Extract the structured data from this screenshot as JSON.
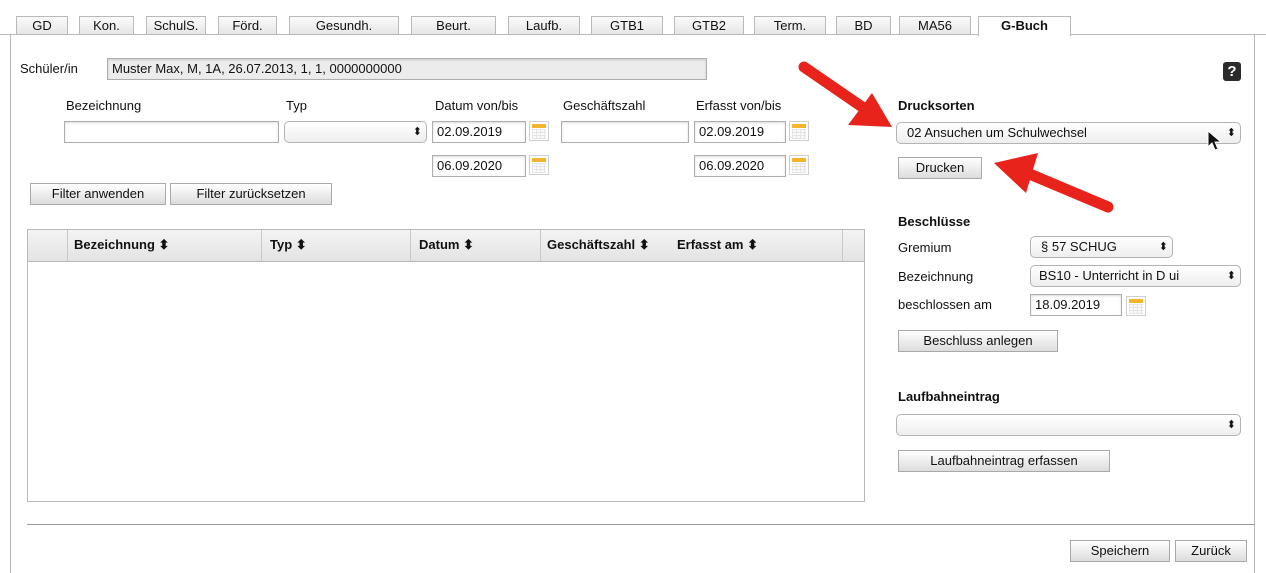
{
  "tabs": [
    {
      "label": "GD"
    },
    {
      "label": "Kon."
    },
    {
      "label": "SchulS."
    },
    {
      "label": "Förd."
    },
    {
      "label": "Gesundh."
    },
    {
      "label": "Beurt."
    },
    {
      "label": "Laufb."
    },
    {
      "label": "GTB1"
    },
    {
      "label": "GTB2"
    },
    {
      "label": "Term."
    },
    {
      "label": "BD"
    },
    {
      "label": "MA56"
    },
    {
      "label": "G-Buch"
    }
  ],
  "student": {
    "label": "Schüler/in",
    "value": "Muster Max, M, 1A, 26.07.2013, 1, 1, 0000000000"
  },
  "help": {
    "label": "?"
  },
  "filter": {
    "bezeichnung_label": "Bezeichnung",
    "typ_label": "Typ",
    "datum_label": "Datum von/bis",
    "gz_label": "Geschäftszahl",
    "erfasst_label": "Erfasst von/bis",
    "datum_from": "02.09.2019",
    "datum_to": "06.09.2020",
    "erfasst_from": "02.09.2019",
    "erfasst_to": "06.09.2020",
    "apply_button": "Filter anwenden",
    "reset_button": "Filter zurücksetzen"
  },
  "table": {
    "columns": [
      "Bezeichnung ⬍",
      "Typ ⬍",
      "Datum ⬍",
      "Geschäftszahl ⬍",
      "Erfasst am ⬍"
    ]
  },
  "drucksorten": {
    "heading": "Drucksorten",
    "selected": "02 Ansuchen um Schulwechsel",
    "print_button": "Drucken"
  },
  "beschluesse": {
    "heading": "Beschlüsse",
    "gremium_label": "Gremium",
    "gremium_value": "§ 57 SCHUG",
    "bezeichnung_label": "Bezeichnung",
    "bezeichnung_value": "BS10 - Unterricht in D ui",
    "date_label": "beschlossen am",
    "date_value": "18.09.2019",
    "create_button": "Beschluss anlegen"
  },
  "laufbahn": {
    "heading": "Laufbahneintrag",
    "selected": "",
    "create_button": "Laufbahneintrag erfassen"
  },
  "footer": {
    "save_button": "Speichern",
    "back_button": "Zurück"
  },
  "colors": {
    "accent_arrow": "#e8231b",
    "calendar": "#f4b52a"
  }
}
